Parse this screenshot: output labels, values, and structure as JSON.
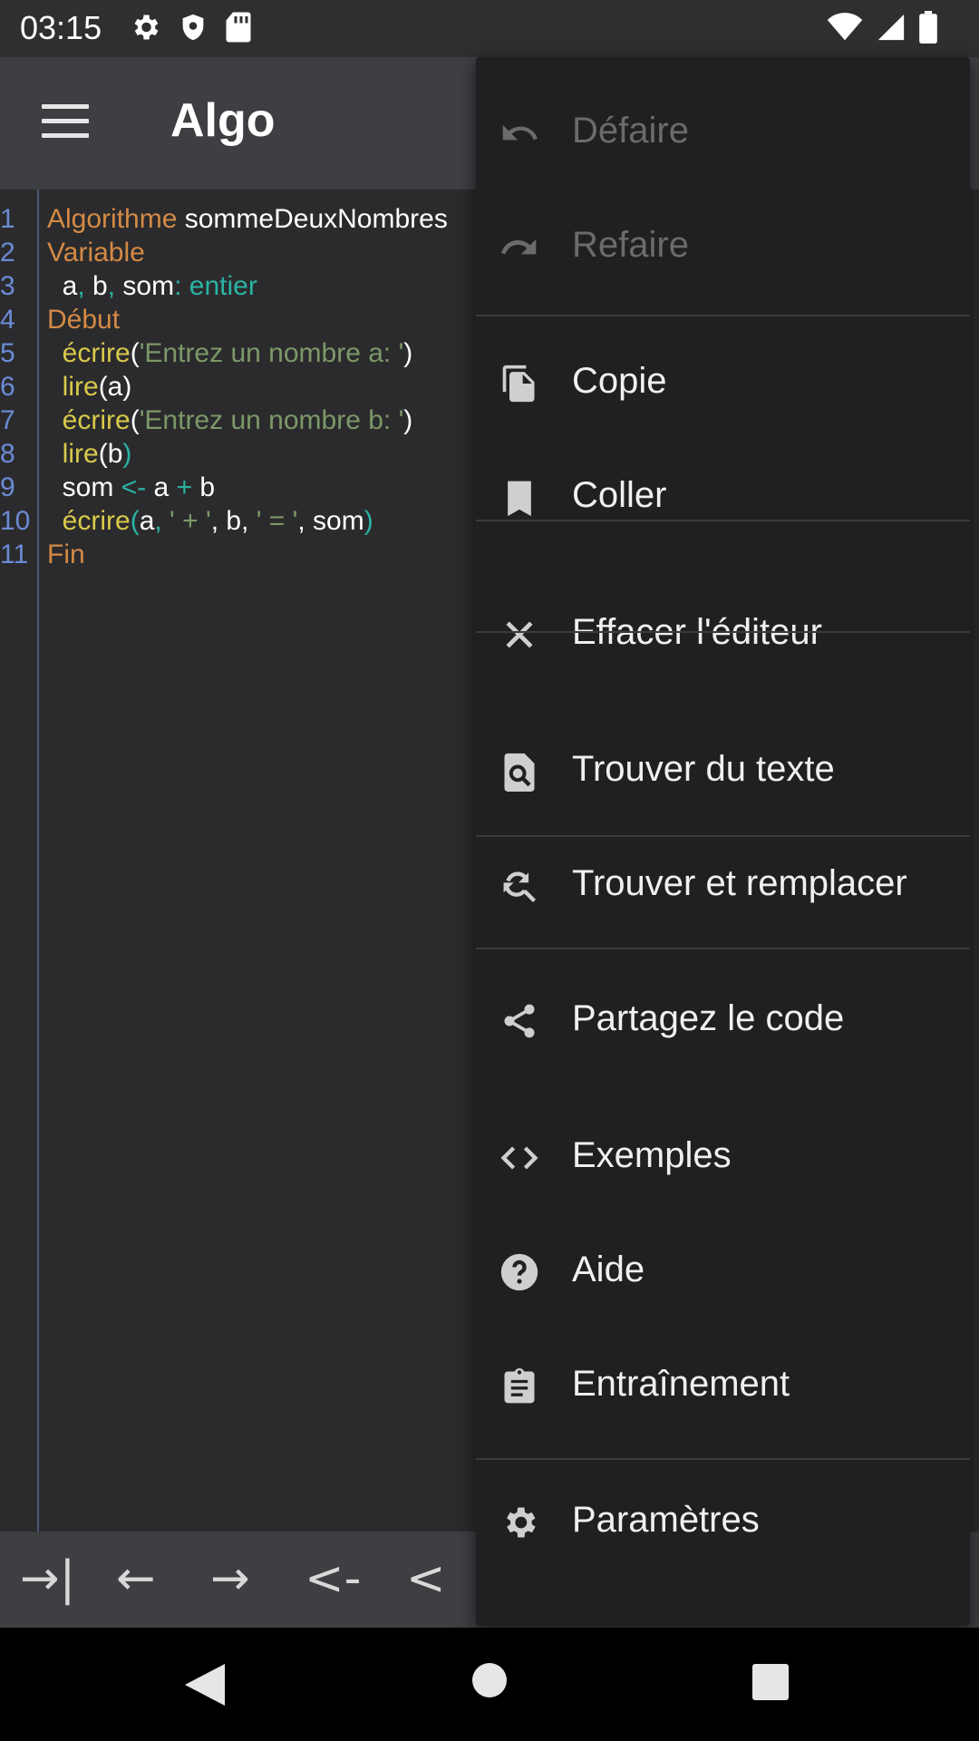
{
  "status_bar": {
    "time": "03:15",
    "icons_left": [
      "gear-icon",
      "shield-icon",
      "sd-card-icon"
    ],
    "icons_right": [
      "wifi-icon",
      "signal-icon",
      "battery-icon"
    ]
  },
  "toolbar": {
    "title": "Algo"
  },
  "editor": {
    "line_numbers": [
      "1",
      "2",
      "3",
      "4",
      "5",
      "6",
      "7",
      "8",
      "9",
      "10",
      "11"
    ],
    "lines": [
      [
        {
          "t": "Algorithme",
          "c": "kw"
        },
        {
          "t": " sommeDeuxNombres",
          "c": "tx"
        }
      ],
      [
        {
          "t": "Variable",
          "c": "kw"
        }
      ],
      [
        {
          "t": "  a",
          "c": "tx"
        },
        {
          "t": ",",
          "c": "op"
        },
        {
          "t": " b",
          "c": "tx"
        },
        {
          "t": ",",
          "c": "op"
        },
        {
          "t": " som",
          "c": "tx"
        },
        {
          "t": ":",
          "c": "op"
        },
        {
          "t": " entier",
          "c": "ty"
        }
      ],
      [
        {
          "t": "Début",
          "c": "kw"
        }
      ],
      [
        {
          "t": "  écrire",
          "c": "fn"
        },
        {
          "t": "(",
          "c": "tx"
        },
        {
          "t": "'Entrez un nombre a: '",
          "c": "str"
        },
        {
          "t": ")",
          "c": "tx"
        }
      ],
      [
        {
          "t": "  lire",
          "c": "fn"
        },
        {
          "t": "(a)",
          "c": "tx"
        }
      ],
      [
        {
          "t": "  écrire",
          "c": "fn"
        },
        {
          "t": "(",
          "c": "tx"
        },
        {
          "t": "'Entrez un nombre b: '",
          "c": "str"
        },
        {
          "t": ")",
          "c": "tx"
        }
      ],
      [
        {
          "t": "  lire",
          "c": "fn"
        },
        {
          "t": "(",
          "c": "tx"
        },
        {
          "t": "b",
          "c": "tx"
        },
        {
          "t": ")",
          "c": "op"
        }
      ],
      [
        {
          "t": "  som ",
          "c": "tx"
        },
        {
          "t": "<-",
          "c": "op"
        },
        {
          "t": " a ",
          "c": "tx"
        },
        {
          "t": "+",
          "c": "op"
        },
        {
          "t": " b",
          "c": "tx"
        }
      ],
      [
        {
          "t": "  écrire",
          "c": "fn"
        },
        {
          "t": "(",
          "c": "op"
        },
        {
          "t": "a",
          "c": "tx"
        },
        {
          "t": ", ",
          "c": "op"
        },
        {
          "t": "' + '",
          "c": "str"
        },
        {
          "t": ", b, ",
          "c": "tx"
        },
        {
          "t": "' = '",
          "c": "str"
        },
        {
          "t": ", som",
          "c": "tx"
        },
        {
          "t": ")",
          "c": "op"
        }
      ],
      [
        {
          "t": "Fin",
          "c": "kw"
        }
      ]
    ]
  },
  "keybar": {
    "keys": [
      "→|",
      "←",
      "→",
      "<-",
      "<"
    ]
  },
  "menu": {
    "items": [
      {
        "label": "Défaire",
        "icon": "undo-icon",
        "disabled": true
      },
      {
        "label": "Refaire",
        "icon": "redo-icon",
        "disabled": true
      },
      {
        "label": "Copie",
        "icon": "copy-icon"
      },
      {
        "label": "Coller",
        "icon": "paste-bookmark-icon"
      },
      {
        "label": "Effacer l'éditeur",
        "icon": "close-icon"
      },
      {
        "label": "Trouver du texte",
        "icon": "find-in-page-icon"
      },
      {
        "label": "Trouver et remplacer",
        "icon": "find-replace-icon"
      },
      {
        "label": "Partagez le code",
        "icon": "share-icon"
      },
      {
        "label": "Exemples",
        "icon": "code-icon"
      },
      {
        "label": "Aide",
        "icon": "help-icon"
      },
      {
        "label": "Entraînement",
        "icon": "assignment-icon"
      },
      {
        "label": "Paramètres",
        "icon": "settings-icon"
      }
    ]
  }
}
